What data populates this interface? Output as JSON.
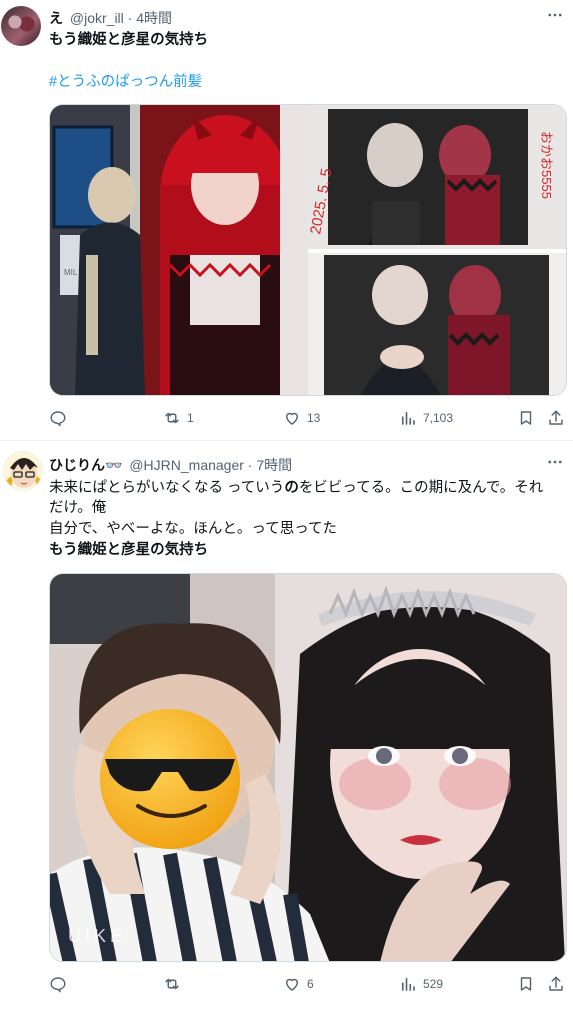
{
  "tweets": [
    {
      "display_name": "え",
      "handle": "@jokr_ill · 4時間",
      "lines": [
        "もう織姫と彦星の気持ち"
      ],
      "hashtag": "#とうふのぱっつん前髪",
      "photo_overlay": {
        "date_text": "2025. 5. 5",
        "note_text": "おかお5555",
        "board_text": "MIL"
      },
      "actions": {
        "replies": "",
        "retweets": "1",
        "likes": "13",
        "views": "7,103"
      }
    },
    {
      "display_name": "ひじりん👓",
      "handle": "@HJRN_manager · 7時間",
      "line1": "未来にぱとらがいなくなる っていう",
      "line1_bold": "の",
      "line1_rest": "をビビってる。この期に及んで。それ",
      "line2": "だけ。俺",
      "line3": "自分で、やべーよな。ほんと。って思ってた",
      "line4": "もう織姫と彦星の気持ち",
      "photo_watermark": "UIKE",
      "actions": {
        "replies": "",
        "retweets": "",
        "likes": "6",
        "views": "529"
      }
    }
  ],
  "colors": {
    "text": "#0f1419",
    "secondary": "#536471",
    "link": "#1d9bf0",
    "border": "#cfd9de"
  }
}
